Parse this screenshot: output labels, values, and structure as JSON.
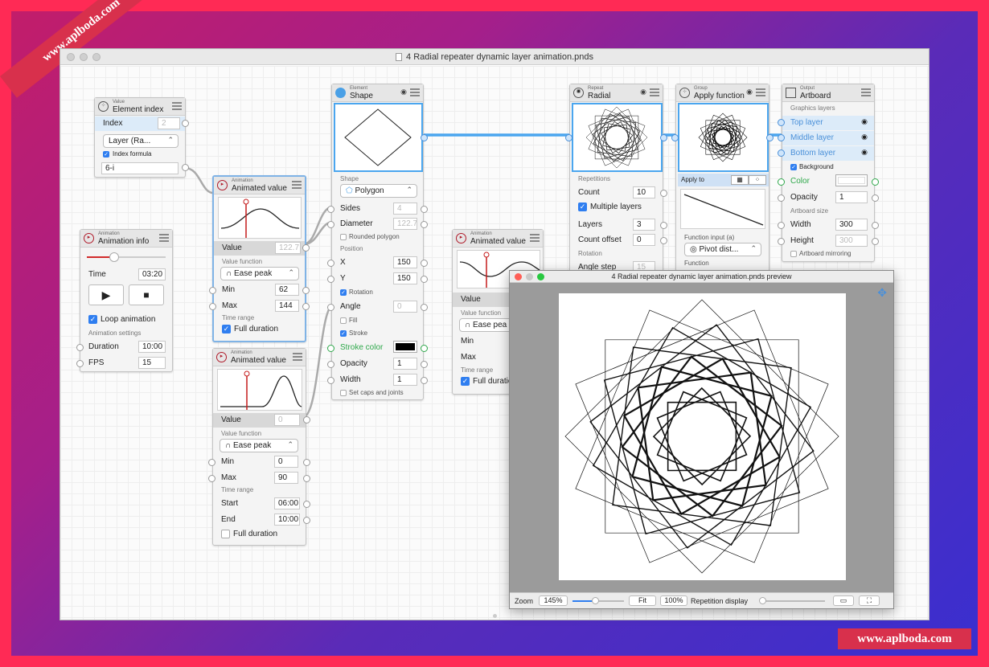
{
  "watermark": {
    "top_left": "www.aplboda.com",
    "bottom_right": "www.aplboda.com"
  },
  "window": {
    "title": "4 Radial repeater dynamic layer animation.pnds"
  },
  "nodes": {
    "element_index": {
      "type": "Value",
      "title": "Element index",
      "index_label": "Index",
      "index_value": "2",
      "layer_popup": "Layer (Ra...",
      "formula_check": "Index formula",
      "formula_value": "6-i"
    },
    "anim_info": {
      "type": "Animation",
      "title": "Animation info",
      "time_label": "Time",
      "time_value": "03:20",
      "loop_label": "Loop animation",
      "settings_label": "Animation settings",
      "duration_label": "Duration",
      "duration_value": "10:00",
      "fps_label": "FPS",
      "fps_value": "15"
    },
    "anim_value_1": {
      "type": "Animation",
      "title": "Animated value",
      "value_label": "Value",
      "value_value": "122.7",
      "func_label": "Value function",
      "func_popup": "Ease peak",
      "min_label": "Min",
      "min_value": "62",
      "max_label": "Max",
      "max_value": "144",
      "range_label": "Time range",
      "full_label": "Full duration"
    },
    "anim_value_2": {
      "type": "Animation",
      "title": "Animated value",
      "value_label": "Value",
      "value_value": "0",
      "func_label": "Value function",
      "func_popup": "Ease peak",
      "min_label": "Min",
      "min_value": "0",
      "max_label": "Max",
      "max_value": "90",
      "range_label": "Time range",
      "start_label": "Start",
      "start_value": "06:00",
      "end_label": "End",
      "end_value": "10:00",
      "full_label": "Full duration"
    },
    "shape": {
      "type": "Element",
      "title": "Shape",
      "shape_section": "Shape",
      "shape_popup": "Polygon",
      "sides_label": "Sides",
      "sides_value": "4",
      "diameter_label": "Diameter",
      "diameter_value": "122.7",
      "rounded_label": "Rounded polygon",
      "position_label": "Position",
      "x_label": "X",
      "x_value": "150",
      "y_label": "Y",
      "y_value": "150",
      "rotation_label": "Rotation",
      "angle_label": "Angle",
      "angle_value": "0",
      "fill_label": "Fill",
      "stroke_label": "Stroke",
      "stroke_color_label": "Stroke color",
      "opacity_label": "Opacity",
      "opacity_value": "1",
      "width_label": "Width",
      "width_value": "1",
      "caps_label": "Set caps and joints"
    },
    "anim_value_3": {
      "type": "Animation",
      "title": "Animated value",
      "value_label": "Value",
      "func_label": "Value function",
      "func_popup": "Ease pea",
      "min_label": "Min",
      "max_label": "Max",
      "range_label": "Time range",
      "full_label": "Full duratio"
    },
    "radial": {
      "type": "Repeat",
      "title": "Radial",
      "reps_label": "Repetitions",
      "count_label": "Count",
      "count_value": "10",
      "multi_label": "Multiple layers",
      "layers_label": "Layers",
      "layers_value": "3",
      "offset_label": "Count offset",
      "offset_value": "0",
      "rotation_label": "Rotation",
      "step_label": "Angle step",
      "step_value": "15"
    },
    "apply_fn": {
      "type": "Group",
      "title": "Apply function",
      "apply_to": "Apply to",
      "input_label": "Function input (a)",
      "input_popup": "Pivot dist...",
      "function_label": "Function"
    },
    "artboard": {
      "type": "Output",
      "title": "Artboard",
      "layers_label": "Graphics layers",
      "top": "Top layer",
      "middle": "Middle layer",
      "bottom": "Bottom layer",
      "bg_label": "Background",
      "color_label": "Color",
      "opacity_label": "Opacity",
      "opacity_value": "1",
      "size_label": "Artboard size",
      "width_label": "Width",
      "width_value": "300",
      "height_label": "Height",
      "height_value": "300",
      "mirror_label": "Artboard mirroring"
    }
  },
  "preview": {
    "title": "4 Radial repeater dynamic layer animation.pnds preview",
    "zoom_label": "Zoom",
    "zoom_value": "145%",
    "fit": "Fit",
    "hundred": "100%",
    "rep_display": "Repetition display"
  },
  "colors": {
    "accent": "#4ba6ef",
    "green": "#2ea84a",
    "red": "#b01b2a"
  }
}
